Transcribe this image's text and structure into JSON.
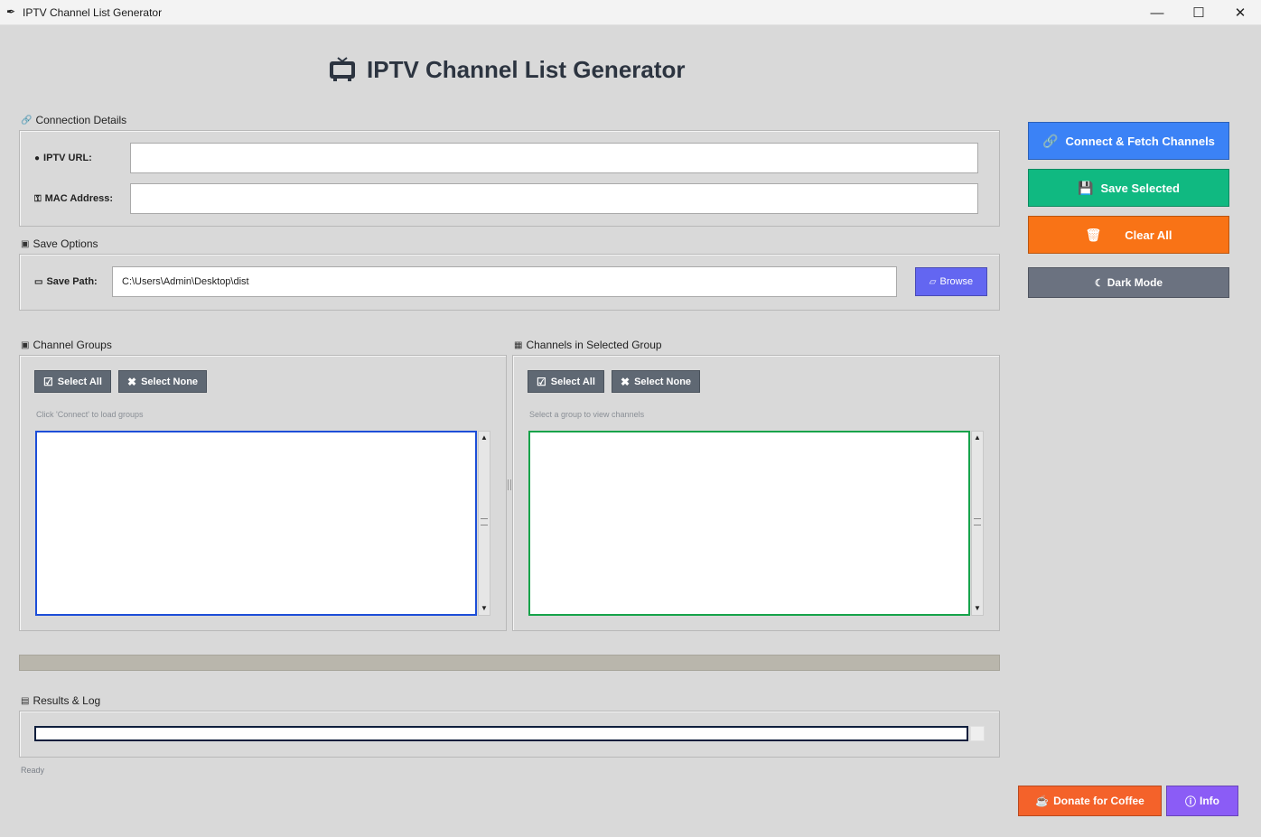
{
  "window": {
    "title": "IPTV Channel List Generator",
    "controls": {
      "minimize": "—",
      "maximize": "☐",
      "close": "✕"
    }
  },
  "header": {
    "title": "IPTV Channel List Generator",
    "icon": "tv-icon"
  },
  "connection": {
    "label": "Connection Details",
    "url_label": "IPTV URL:",
    "url_value": "",
    "mac_label": "MAC Address:",
    "mac_value": ""
  },
  "save_options": {
    "label": "Save Options",
    "path_label": "Save Path:",
    "path_value": "C:\\Users\\Admin\\Desktop\\dist",
    "browse_label": "Browse"
  },
  "actions": {
    "connect_label": "Connect & Fetch Channels",
    "save_label": "Save Selected",
    "clear_label": "Clear All",
    "dark_mode_label": "Dark Mode"
  },
  "groups_panel": {
    "label": "Channel Groups",
    "select_all": "Select All",
    "select_none": "Select None",
    "hint": "Click 'Connect' to load groups",
    "items": []
  },
  "channels_panel": {
    "label": "Channels in Selected Group",
    "select_all": "Select All",
    "select_none": "Select None",
    "hint": "Select a group to view channels",
    "items": []
  },
  "progress": {
    "value": 0
  },
  "results": {
    "label": "Results & Log",
    "log_text": ""
  },
  "status": {
    "text": "Ready"
  },
  "footer": {
    "donate_label": "Donate for Coffee",
    "info_label": "Info"
  },
  "colors": {
    "connect": "#3b82f6",
    "save": "#10b981",
    "clear": "#f97316",
    "dark_mode": "#6b7280",
    "browse": "#6366f1",
    "donate": "#f4622a",
    "info": "#8b5cf6",
    "groups_border": "#1d4ed8",
    "channels_border": "#16a34a"
  }
}
